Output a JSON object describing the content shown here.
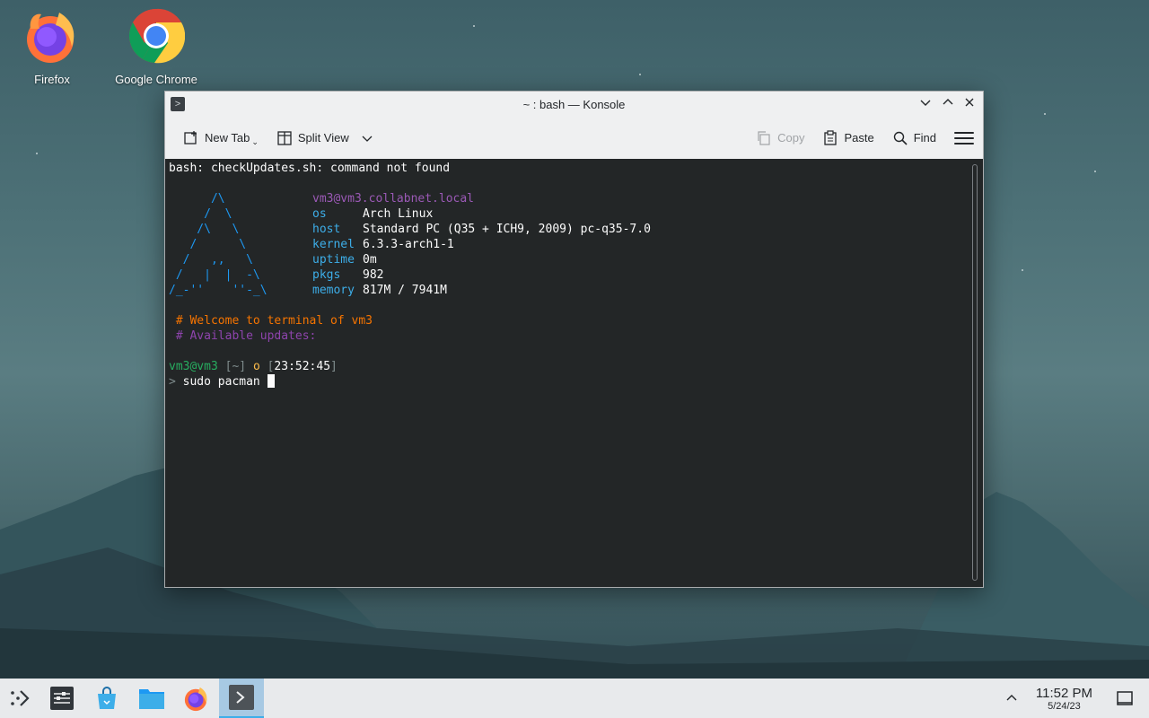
{
  "desktop": {
    "icons": [
      {
        "label": "Firefox"
      },
      {
        "label": "Google Chrome"
      }
    ]
  },
  "window": {
    "title": "~ : bash — Konsole",
    "toolbar": {
      "new_tab": "New Tab",
      "split_view": "Split View",
      "copy": "Copy",
      "paste": "Paste",
      "find": "Find"
    }
  },
  "terminal": {
    "error_line": "bash: checkUpdates.sh: command not found",
    "ascii": [
      "      /\\",
      "     /  \\",
      "    /\\   \\",
      "   /      \\",
      "  /   ,,   \\",
      " /   |  |  -\\",
      "/_-''    ''-_\\"
    ],
    "user_host": "vm3@vm3.collabnet.local",
    "info": [
      {
        "label": "os",
        "value": "Arch Linux"
      },
      {
        "label": "host",
        "value": "Standard PC (Q35 + ICH9, 2009) pc-q35-7.0"
      },
      {
        "label": "kernel",
        "value": "6.3.3-arch1-1"
      },
      {
        "label": "uptime",
        "value": "0m"
      },
      {
        "label": "pkgs",
        "value": "982"
      },
      {
        "label": "memory",
        "value": "817M / 7941M"
      }
    ],
    "welcome": "# Welcome to terminal of vm3",
    "updates": "# Available updates:",
    "prompt_user": "vm3@vm3",
    "prompt_dir": "[~]",
    "prompt_o": "o",
    "prompt_time": "23:52:45",
    "prompt_arrow": ">",
    "command": "sudo pacman"
  },
  "taskbar": {
    "time": "11:52 PM",
    "date": "5/24/23"
  },
  "colors": {
    "terminal_bg": "#232627",
    "accent": "#3daee9",
    "purple": "#9b59b6",
    "orange": "#f67400",
    "green": "#27ae60"
  }
}
